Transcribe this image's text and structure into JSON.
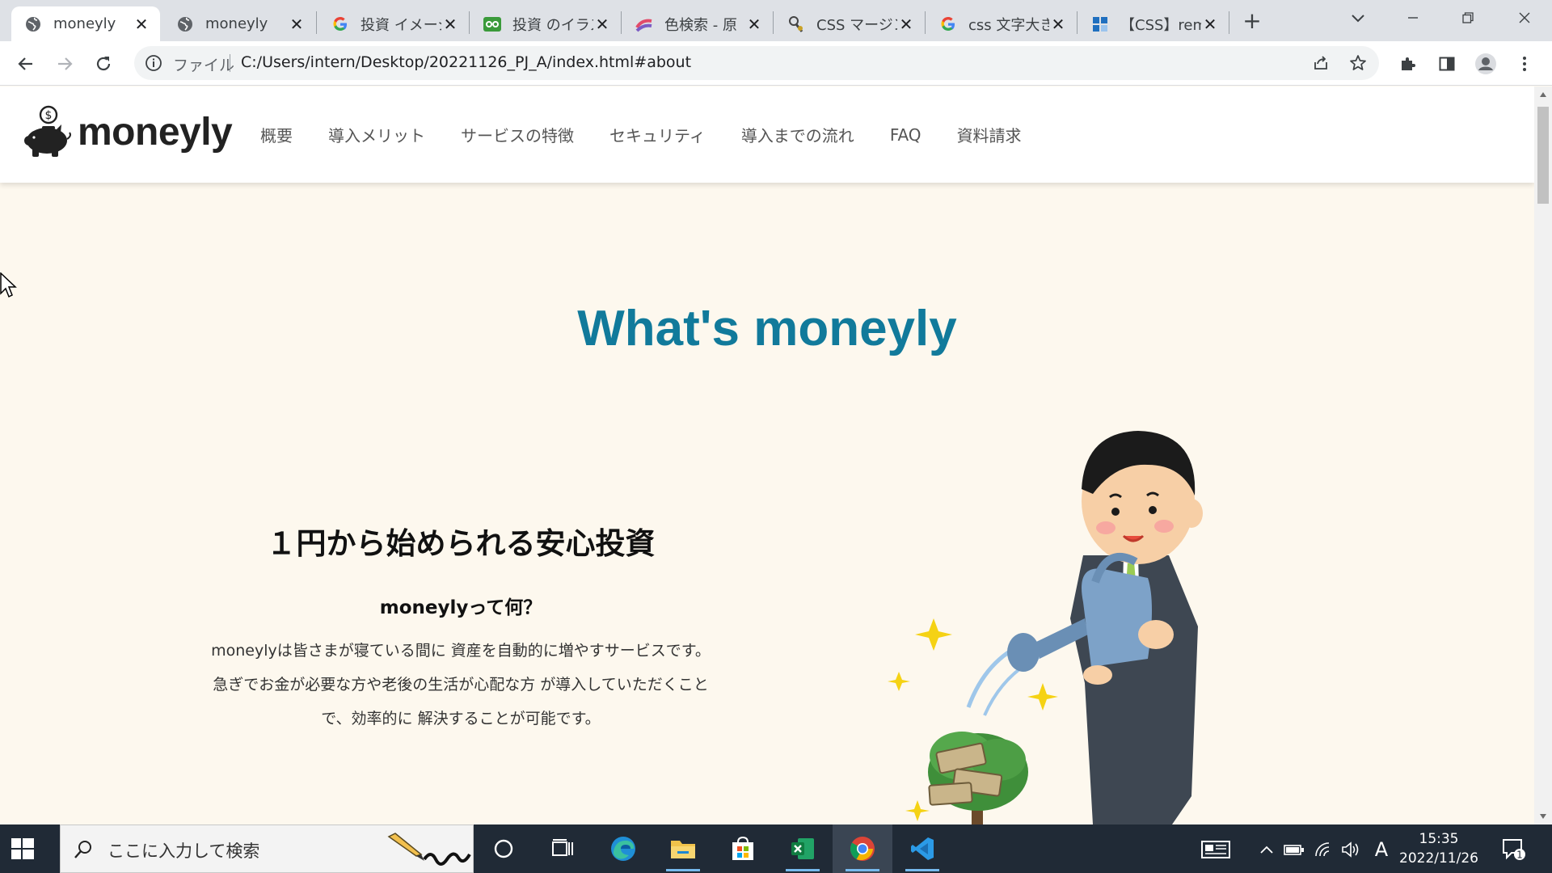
{
  "browser": {
    "tabs": [
      {
        "title": "moneyly",
        "favicon": "globe-icon",
        "active": true
      },
      {
        "title": "moneyly",
        "favicon": "globe-icon",
        "active": false
      },
      {
        "title": "投資 イメージ",
        "favicon": "google-icon",
        "active": false
      },
      {
        "title": "投資 のイラスト",
        "favicon": "irasutoya-icon",
        "active": false
      },
      {
        "title": "色検索 - 原",
        "favicon": "color-icon",
        "active": false
      },
      {
        "title": "CSS マージン",
        "favicon": "css-icon",
        "active": false
      },
      {
        "title": "css 文字大き",
        "favicon": "google-icon",
        "active": false
      },
      {
        "title": "【CSS】rem と",
        "favicon": "blog-icon",
        "active": false
      }
    ],
    "new_tab_label": "+",
    "omnibox": {
      "scheme_label": "ファイル",
      "url": "C:/Users/intern/Desktop/20221126_PJ_A/index.html#about"
    }
  },
  "site": {
    "logo_text": "moneyly",
    "nav": [
      "概要",
      "導入メリット",
      "サービスの特徴",
      "セキュリティ",
      "導入までの流れ",
      "FAQ",
      "資料請求"
    ],
    "section_title": "What's moneyly",
    "about": {
      "heading": "１円から始められる安心投資",
      "subheading": "moneylyって何？",
      "body_lines": [
        "moneylyは皆さまが寝ている間に 資産を自動的に増やすサービスです。",
        "急ぎでお金が必要な方や老後の生活が心配な方 が導入していただくこと",
        "で、効率的に 解決することが可能です。"
      ]
    }
  },
  "taskbar": {
    "search_placeholder": "ここに入力して検索",
    "time": "15:35",
    "date": "2022/11/26",
    "ime_label": "A",
    "notification_count": "1"
  },
  "colors": {
    "accent": "#117a9b",
    "page_bg": "#fdf8ee",
    "taskbar_bg": "#202a36"
  }
}
